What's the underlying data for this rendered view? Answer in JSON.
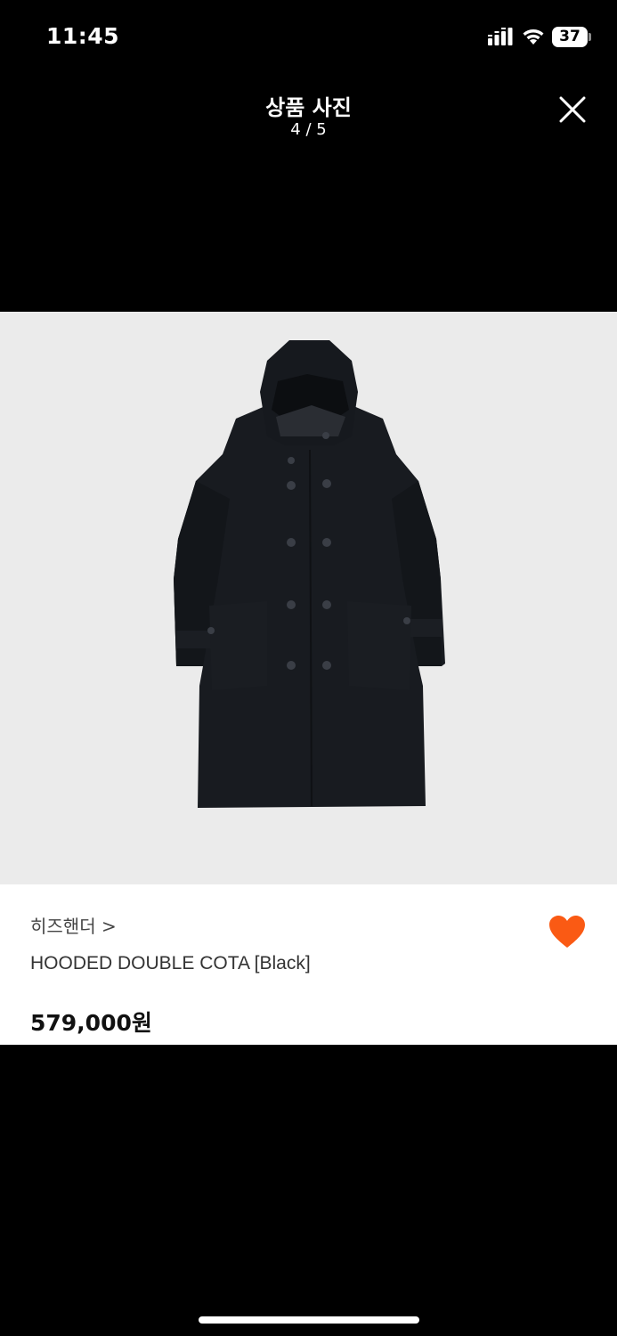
{
  "status_bar": {
    "time": "11:45",
    "battery": "37",
    "signal_icon": "cellular-signal-icon",
    "wifi_icon": "wifi-icon",
    "battery_icon": "battery-icon"
  },
  "header": {
    "title": "상품 사진",
    "counter": "4 / 5",
    "close_icon": "close-icon"
  },
  "product": {
    "brand": "히즈핸더 >",
    "name": "HOODED DOUBLE COTA [Black]",
    "price": "579,000원",
    "like_icon": "heart-icon",
    "like_color": "#fa5a14",
    "liked": true
  },
  "colors": {
    "background": "#000000",
    "image_bg": "#ebebeb",
    "card_bg": "#ffffff",
    "accent": "#fa5a14"
  }
}
